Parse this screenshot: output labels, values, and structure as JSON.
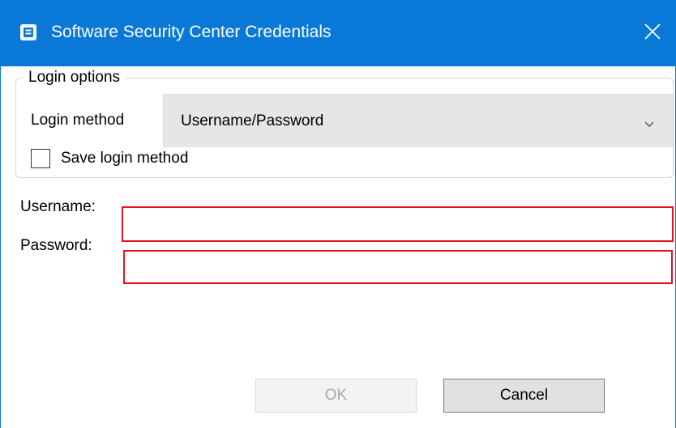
{
  "window": {
    "title": "Software Security Center Credentials",
    "app_icon": "app-icon",
    "close_icon": "close-icon",
    "accent_color": "#0a78d7"
  },
  "login_options": {
    "legend": "Login options",
    "method_label": "Login method",
    "method_value": "Username/Password",
    "save_label": "Save login method",
    "save_checked": false
  },
  "credentials": {
    "username_label": "Username:",
    "username_value": "",
    "password_label": "Password:",
    "password_value": "",
    "error_border_color": "#e81123"
  },
  "buttons": {
    "ok_label": "OK",
    "ok_enabled": false,
    "cancel_label": "Cancel"
  }
}
